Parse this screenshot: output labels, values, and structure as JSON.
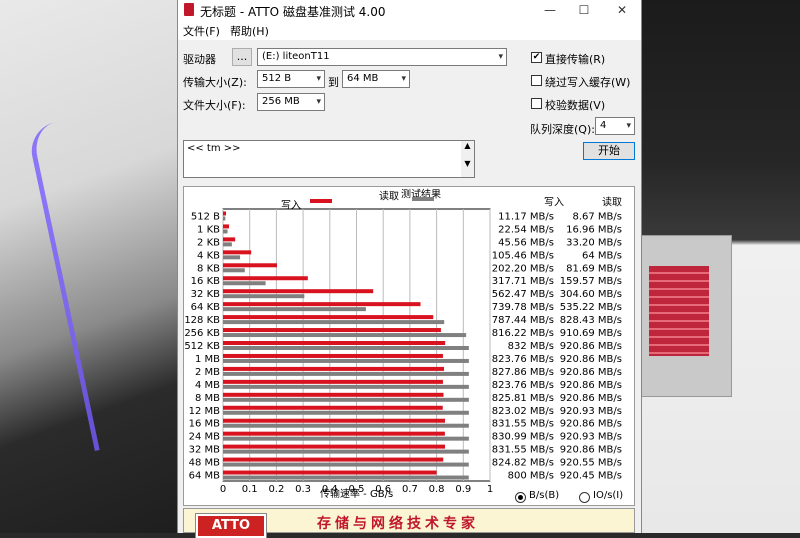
{
  "window": {
    "title": "无标题 - ATTO 磁盘基准测试 4.00",
    "menu": [
      "文件(F)",
      "帮助(H)"
    ]
  },
  "controls": {
    "drive_label": "驱动器",
    "drive_browse": "...",
    "drive_value": "(E:) liteonT11",
    "transfer_label": "传输大小(Z):",
    "transfer_from": "512 B",
    "transfer_to_label": "到",
    "transfer_to": "64 MB",
    "filesize_label": "文件大小(F):",
    "filesize_value": "256 MB",
    "direct_io": {
      "label": "直接传输(R)",
      "checked": true
    },
    "bypass_cache": {
      "label": "绕过写入缓存(W)",
      "checked": false
    },
    "verify": {
      "label": "校验数据(V)",
      "checked": false
    },
    "queue_label": "队列深度(Q):",
    "queue_value": "4",
    "start_button": "开始",
    "notes": "<< tm >>"
  },
  "results": {
    "header": "测试结果",
    "legend_write": "写入",
    "legend_read": "读取",
    "col_write": "写入",
    "col_read": "读取",
    "unit_bs": "B/s(B)",
    "unit_io": "IO/s(I)",
    "unit_selected": "B/s"
  },
  "chart_data": {
    "type": "bar",
    "orientation": "horizontal",
    "xlabel": "传输速率 - GB/s",
    "xlim": [
      0,
      1
    ],
    "xticks": [
      "0",
      "0.1",
      "0.2",
      "0.3",
      "0.4",
      "0.5",
      "0.6",
      "0.7",
      "0.8",
      "0.9",
      "1"
    ],
    "categories": [
      "512 B",
      "1 KB",
      "2 KB",
      "4 KB",
      "8 KB",
      "16 KB",
      "32 KB",
      "64 KB",
      "128 KB",
      "256 KB",
      "512 KB",
      "1 MB",
      "2 MB",
      "4 MB",
      "8 MB",
      "12 MB",
      "16 MB",
      "24 MB",
      "32 MB",
      "48 MB",
      "64 MB"
    ],
    "series": [
      {
        "name": "写入",
        "color": "#d8131f",
        "values": [
          0.01117,
          0.02254,
          0.04556,
          0.10546,
          0.2022,
          0.31771,
          0.56247,
          0.73978,
          0.78744,
          0.81622,
          0.832,
          0.82376,
          0.82786,
          0.82376,
          0.82581,
          0.82302,
          0.83155,
          0.83099,
          0.83155,
          0.82482,
          0.8
        ]
      },
      {
        "name": "读取",
        "color": "#808080",
        "values": [
          0.00867,
          0.01696,
          0.0332,
          0.064,
          0.08169,
          0.15957,
          0.3046,
          0.53522,
          0.82843,
          0.91069,
          0.92086,
          0.92086,
          0.92086,
          0.92086,
          0.92086,
          0.92093,
          0.92086,
          0.92093,
          0.92086,
          0.92055,
          0.92045
        ]
      }
    ],
    "write_labels": [
      "11.17 MB/s",
      "22.54 MB/s",
      "45.56 MB/s",
      "105.46 MB/s",
      "202.20 MB/s",
      "317.71 MB/s",
      "562.47 MB/s",
      "739.78 MB/s",
      "787.44 MB/s",
      "816.22 MB/s",
      "832 MB/s",
      "823.76 MB/s",
      "827.86 MB/s",
      "823.76 MB/s",
      "825.81 MB/s",
      "823.02 MB/s",
      "831.55 MB/s",
      "830.99 MB/s",
      "831.55 MB/s",
      "824.82 MB/s",
      "800 MB/s"
    ],
    "read_labels": [
      "8.67 MB/s",
      "16.96 MB/s",
      "33.20 MB/s",
      "64 MB/s",
      "81.69 MB/s",
      "159.57 MB/s",
      "304.60 MB/s",
      "535.22 MB/s",
      "828.43 MB/s",
      "910.69 MB/s",
      "920.86 MB/s",
      "920.86 MB/s",
      "920.86 MB/s",
      "920.86 MB/s",
      "920.86 MB/s",
      "920.93 MB/s",
      "920.86 MB/s",
      "920.93 MB/s",
      "920.86 MB/s",
      "920.55 MB/s",
      "920.45 MB/s"
    ]
  },
  "banner": {
    "logo": "ATTO",
    "slogan": "存储与网络技术专家"
  }
}
